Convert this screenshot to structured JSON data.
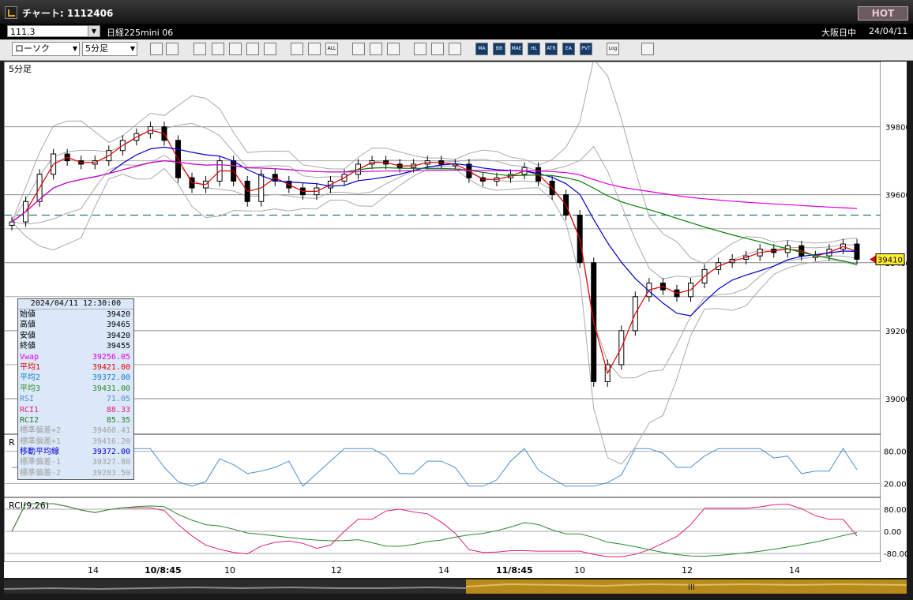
{
  "window": {
    "title": "チャート: 1112406",
    "hot_label": "HOT"
  },
  "bar1": {
    "code": "111.3",
    "instrument": "日経225mini 06",
    "session": "大阪日中",
    "date": "24/04/11"
  },
  "toolbar": {
    "chart_type": "ローソク",
    "interval": "5分足",
    "buttons": [
      "zoom",
      "cursor",
      "candle-a",
      "candle-b",
      "candle-c",
      "candle-d",
      "grey",
      "bars-a",
      "bars-b",
      "ALL",
      "pen",
      "arrow-select",
      "arrow-draw",
      "palette-a",
      "brush",
      "gradient",
      "MA",
      "BB",
      "MAE",
      "HL",
      "ATR",
      "EA",
      "PVT",
      "Log",
      "export"
    ]
  },
  "panes": {
    "main_label": "5分足",
    "rsi_label": "R",
    "rci_label": "RCI(9,26)"
  },
  "price_axis": {
    "ticks": [
      "39800",
      "39600",
      "39400",
      "39200",
      "39000"
    ],
    "current": "39410"
  },
  "rsi_axis": {
    "ticks": [
      "80.00",
      "20.00"
    ]
  },
  "rci_axis": {
    "ticks": [
      "80.00",
      "0.00",
      "-80.00"
    ]
  },
  "time_axis": {
    "labels": [
      "14",
      "10/8:45",
      "10",
      "12",
      "14",
      "11/8:45",
      "10",
      "12",
      "14"
    ]
  },
  "colors": {
    "up_candle": "#ffffff",
    "down_candle": "#000000",
    "ma1": "#e00000",
    "ma2": "#0000cc",
    "ma3": "#008000",
    "vwap": "#e000e0",
    "bb": "#aaaaaa",
    "rsi": "#4a90d9",
    "rci1": "#e0207a",
    "rci2": "#2a8a2a"
  },
  "info": {
    "header": "2024/04/11  12:30:00",
    "rows": [
      {
        "k": "始値",
        "v": "39420",
        "c": "#000000"
      },
      {
        "k": "高値",
        "v": "39465",
        "c": "#000000"
      },
      {
        "k": "安値",
        "v": "39420",
        "c": "#000000"
      },
      {
        "k": "終値",
        "v": "39455",
        "c": "#000000"
      },
      {
        "k": "Vwap",
        "v": "39256.05",
        "c": "#e000e0"
      },
      {
        "k": "平均1",
        "v": "39421.00",
        "c": "#e00000"
      },
      {
        "k": "平均2",
        "v": "39372.00",
        "c": "#1a7ac8"
      },
      {
        "k": "平均3",
        "v": "39431.00",
        "c": "#2a8a2a"
      },
      {
        "k": "RSI",
        "v": "71.05",
        "c": "#5a8ad8"
      },
      {
        "k": "RCI1",
        "v": "88.33",
        "c": "#e0207a"
      },
      {
        "k": "RCI2",
        "v": "85.35",
        "c": "#2a7a2a"
      },
      {
        "k": "標準偏差+2",
        "v": "39460.41",
        "c": "#a0a0a0"
      },
      {
        "k": "標準偏差+1",
        "v": "39416.20",
        "c": "#a0a0a0"
      },
      {
        "k": "移動平均線",
        "v": "39372.00",
        "c": "#0000cc"
      },
      {
        "k": "標準偏差-1",
        "v": "39327.80",
        "c": "#a0a0a0"
      },
      {
        "k": "標準偏差-2",
        "v": "39283.59",
        "c": "#a0a0a0"
      }
    ]
  },
  "chart_data": {
    "type": "line",
    "x_labels": [
      "14",
      "10/8:45",
      "10",
      "12",
      "14",
      "11/8:45",
      "10",
      "12",
      "14"
    ],
    "ylim": [
      38900,
      39950
    ],
    "close": [
      39520,
      39580,
      39660,
      39720,
      39700,
      39690,
      39700,
      39730,
      39760,
      39780,
      39800,
      39760,
      39650,
      39620,
      39640,
      39700,
      39640,
      39580,
      39660,
      39640,
      39620,
      39600,
      39620,
      39640,
      39660,
      39690,
      39700,
      39690,
      39680,
      39690,
      39700,
      39690,
      39690,
      39650,
      39640,
      39650,
      39660,
      39680,
      39640,
      39600,
      39540,
      39400,
      39050,
      39100,
      39200,
      39300,
      39340,
      39320,
      39300,
      39340,
      39380,
      39400,
      39410,
      39420,
      39440,
      39430,
      39450,
      39420,
      39420,
      39440,
      39455,
      39410
    ],
    "reference_line": 39540,
    "rsi_last": 71.05,
    "rci1_last": 88.33,
    "rci2_last": 85.35
  }
}
